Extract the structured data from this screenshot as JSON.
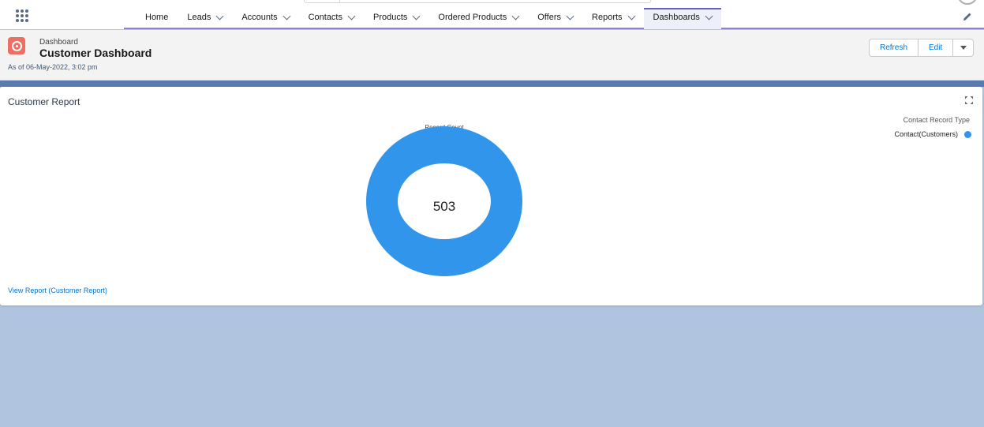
{
  "nav": {
    "tabs": [
      {
        "label": "Home",
        "has_menu": false
      },
      {
        "label": "Leads",
        "has_menu": true
      },
      {
        "label": "Accounts",
        "has_menu": true
      },
      {
        "label": "Contacts",
        "has_menu": true
      },
      {
        "label": "Products",
        "has_menu": true
      },
      {
        "label": "Ordered Products",
        "has_menu": true
      },
      {
        "label": "Offers",
        "has_menu": true
      },
      {
        "label": "Reports",
        "has_menu": true
      },
      {
        "label": "Dashboards",
        "has_menu": true,
        "active": true
      }
    ],
    "icons": [
      "app-launcher-icon",
      "pencil-icon"
    ]
  },
  "header": {
    "eyebrow": "Dashboard",
    "title": "Customer Dashboard",
    "as_of": "As of 06-May-2022, 3:02 pm",
    "refresh_label": "Refresh",
    "edit_label": "Edit",
    "icon": "dashboard-gauge-icon"
  },
  "card": {
    "title": "Customer Report",
    "view_report_label": "View Report (Customer Report)",
    "expand_icon": "expand-icon"
  },
  "chart_data": {
    "type": "pie",
    "donut": true,
    "title": "Record Count",
    "center_label": "503",
    "legend_title": "Contact Record Type",
    "legend_placement": "top-right",
    "categories": [
      "Contact(Customers)"
    ],
    "values": [
      503
    ],
    "colors": [
      "#3295ec"
    ]
  },
  "colors": {
    "accent": "#6a5acd",
    "link": "#0176d3",
    "dashboard_icon": "#ef6e64",
    "page_background": "#b0c4df",
    "donut": "#3295ec"
  }
}
